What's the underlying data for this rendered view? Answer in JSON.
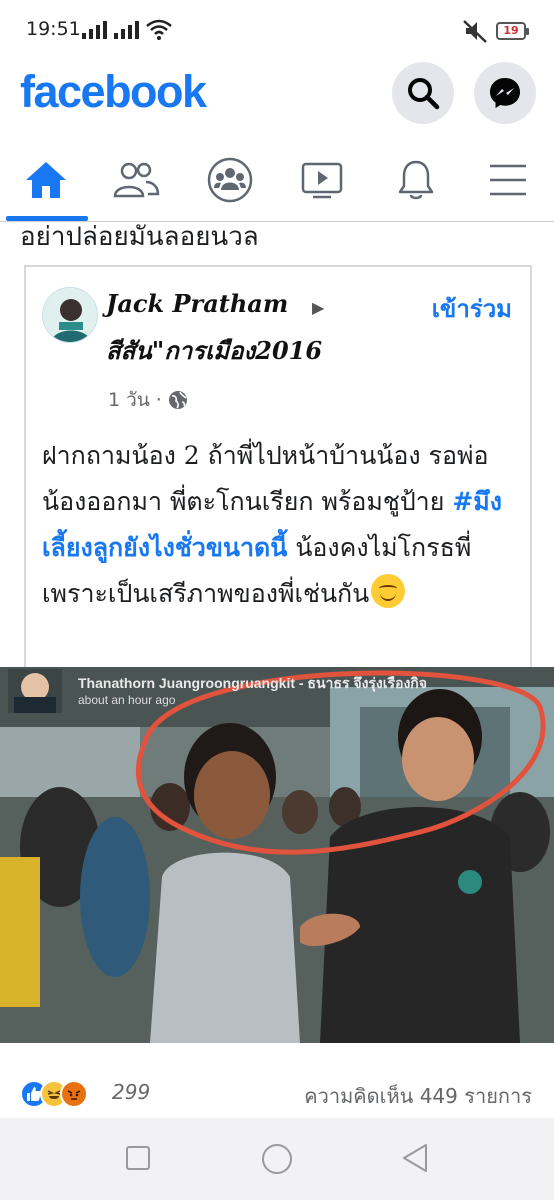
{
  "status_bar": {
    "time": "19:51",
    "battery": "19",
    "icons": [
      "signal-icon",
      "signal-icon",
      "wifi-icon",
      "mute-icon",
      "battery-icon"
    ]
  },
  "header": {
    "logo": "facebook",
    "brand_color": "#1877f2",
    "buttons": [
      "search-icon",
      "messenger-icon"
    ]
  },
  "tabs": [
    {
      "icon": "home-icon",
      "active": true
    },
    {
      "icon": "friends-icon",
      "active": false
    },
    {
      "icon": "groups-icon",
      "active": false
    },
    {
      "icon": "watch-icon",
      "active": false
    },
    {
      "icon": "bell-icon",
      "active": false
    },
    {
      "icon": "menu-icon",
      "active": false
    }
  ],
  "feed": {
    "previous_post_text": "อย่าปล่อยมันลอยนวล"
  },
  "post": {
    "author": "Jack Pratham",
    "group": "สีสัน\"การเมือง2016",
    "join_label": "เข้าร่วม",
    "time": "1 วัน",
    "privacy_icon": "globe-icon",
    "body_before": "ฝากถามน้อง 2 ถ้าพี่ไปหน้าบ้านน้อง รอพ่อน้องออกมา พี่ตะโกนเรียก พร้อมชูป้าย ",
    "hashtag": "#มึงเลี้ยงลูกยังไงชั่วขนาดนี้",
    "body_after": " น้องคงไม่โกรธพี่ เพราะเป็นเสรีภาพของพี่เช่นกัน",
    "image": {
      "overlay_name": "Thanathorn Juangroongruangkit - ธนาธร จึงรุ่งเรืองกิจ",
      "overlay_time": "about an hour ago"
    },
    "reactions": {
      "icons": [
        "like-icon",
        "haha-icon",
        "angry-icon"
      ],
      "count": "299",
      "comments": "ความคิดเห็น 449 รายการ"
    }
  },
  "android_nav": [
    "recent-apps-button",
    "home-button",
    "back-button"
  ]
}
